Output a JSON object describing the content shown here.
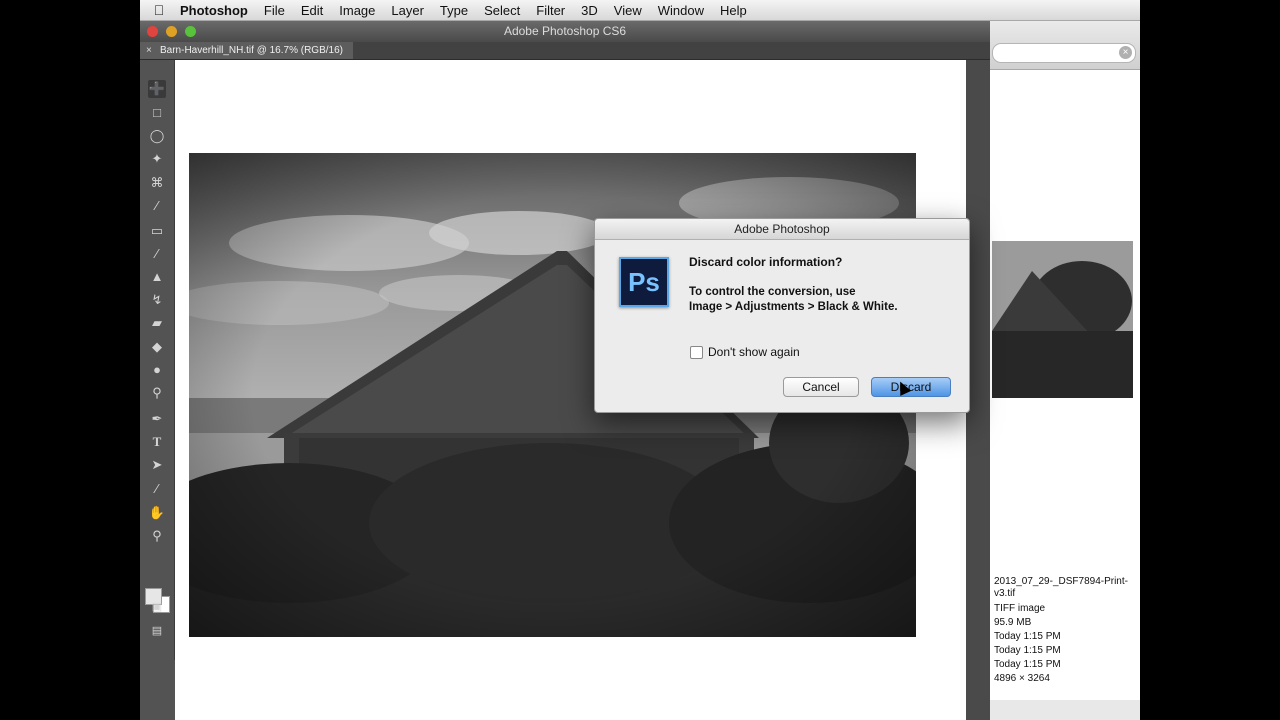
{
  "menubar": {
    "app_name": "Photoshop",
    "items": [
      "File",
      "Edit",
      "Image",
      "Layer",
      "Type",
      "Select",
      "Filter",
      "3D",
      "View",
      "Window",
      "Help"
    ]
  },
  "window": {
    "title": "Adobe Photoshop CS6",
    "doc_tab": "Barn-Haverhill_NH.tif @ 16.7% (RGB/16)"
  },
  "tools": [
    "move-tool-icon",
    "marquee-tool-icon",
    "lasso-tool-icon",
    "magic-wand-icon",
    "crop-tool-icon",
    "eyedropper-icon",
    "healing-brush-icon",
    "brush-tool-icon",
    "clone-stamp-icon",
    "history-brush-icon",
    "eraser-icon",
    "paint-bucket-icon",
    "blur-tool-icon",
    "dodge-tool-icon",
    "pen-tool-icon",
    "type-tool-icon",
    "path-selection-icon",
    "line-tool-icon",
    "hand-tool-icon",
    "zoom-tool-icon"
  ],
  "dialog": {
    "title": "Adobe Photoshop",
    "logo_text": "Ps",
    "heading": "Discard color information?",
    "body_line1": "To control the conversion, use",
    "body_line2": "Image > Adjustments > Black & White.",
    "checkbox_label": "Don't show again",
    "checkbox_checked": false,
    "cancel_label": "Cancel",
    "discard_label": "Discard"
  },
  "finder": {
    "filename": "2013_07_29-_DSF7894-Print-v3.tif",
    "kind": "TIFF image",
    "size": "95.9 MB",
    "created": "Today 1:15 PM",
    "modified": "Today 1:15 PM",
    "last_opened": "Today 1:15 PM",
    "dimensions": "4896 × 3264"
  }
}
